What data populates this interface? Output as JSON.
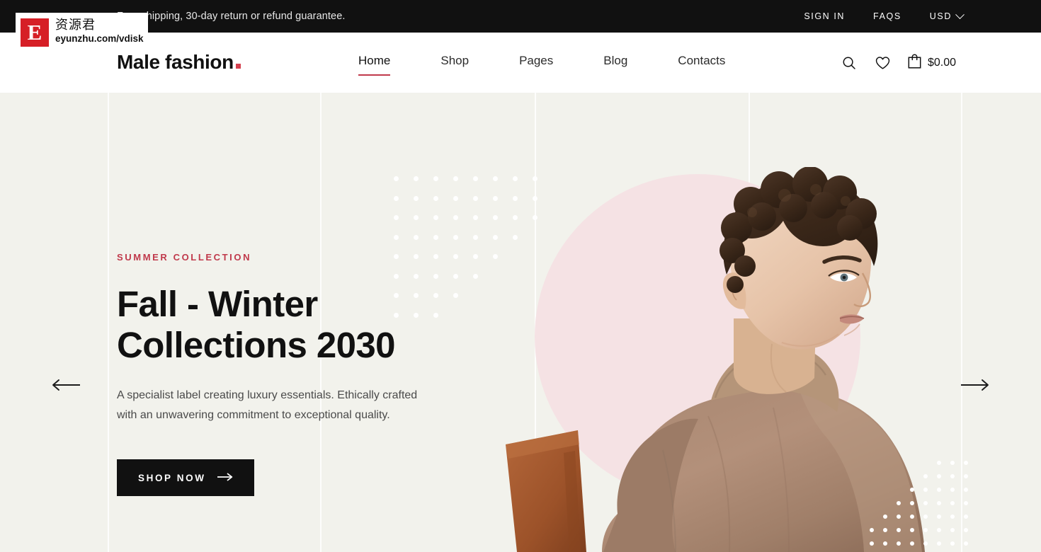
{
  "topbar": {
    "promo": "Free shipping, 30-day return or refund guarantee.",
    "sign_in": "SIGN IN",
    "faqs": "FAQS",
    "currency": "USD",
    "chevron_icon": "chevron-down-icon",
    "background_color": "#111111"
  },
  "header": {
    "logo_text": "Male fashion",
    "logo_dot_color": "#d4404f",
    "nav": [
      {
        "label": "Home",
        "active": true
      },
      {
        "label": "Shop",
        "active": false
      },
      {
        "label": "Pages",
        "active": false
      },
      {
        "label": "Blog",
        "active": false
      },
      {
        "label": "Contacts",
        "active": false
      }
    ],
    "active_underline_color": "#c0394b",
    "icons": [
      {
        "name": "search-icon"
      },
      {
        "name": "heart-icon"
      },
      {
        "name": "shopping-bag-icon"
      }
    ],
    "cart_total": "$0.00"
  },
  "hero": {
    "eyebrow": "SUMMER COLLECTION",
    "eyebrow_color": "#c0394b",
    "title": "Fall - Winter\nCollections 2030",
    "description": "A specialist label creating luxury essentials. Ethically crafted with an unwavering commitment to exceptional quality.",
    "cta_label": "SHOP NOW",
    "cta_arrow_icon": "arrow-right-icon",
    "prev_icon": "arrow-left-icon",
    "next_icon": "arrow-right-icon",
    "background_color": "#f2f2ec",
    "circle_color": "#f5e2e4",
    "dot_color": "#ffffff",
    "model_alt": "Male model in tan turtleneck sweater seated on wooden chair"
  },
  "watermark": {
    "logo_letter": "E",
    "chinese_text": "资源君",
    "url": "eyunzhu.com/vdisk",
    "logo_color": "#d61f26"
  }
}
